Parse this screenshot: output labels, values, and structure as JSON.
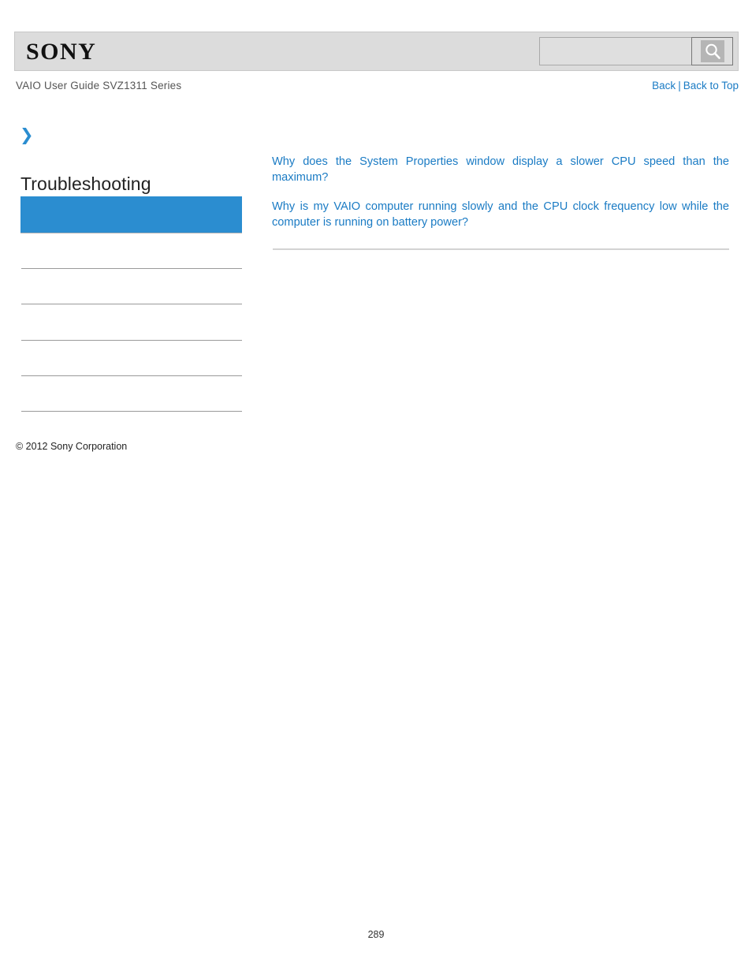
{
  "header": {
    "logo_text": "SONY",
    "search": {
      "value": "",
      "placeholder": "",
      "icon": "search-icon",
      "button_label": ""
    }
  },
  "subheader": {
    "guide_title": "VAIO User Guide SVZ1311 Series",
    "nav": {
      "back_label": "Back",
      "separator": "|",
      "back_to_top_label": "Back to Top"
    }
  },
  "sidebar": {
    "expand_icon": "chevron-right-icon",
    "heading": "Troubleshooting",
    "active_item_label": "",
    "items": [
      {
        "label": ""
      },
      {
        "label": ""
      },
      {
        "label": ""
      },
      {
        "label": ""
      },
      {
        "label": ""
      }
    ],
    "copyright": "© 2012 Sony Corporation"
  },
  "main": {
    "links": [
      "Why does the System Properties window display a slower CPU speed than the maximum?",
      "Why is my VAIO computer running slowly and the CPU clock frequency low while the computer is running on battery power?"
    ]
  },
  "footer": {
    "page_number": "289"
  },
  "colors": {
    "link_blue": "#1a7bc4",
    "accent_blue": "#2b8dd0",
    "header_gray": "#dcdcdc",
    "rule_gray": "#9a9a9a"
  }
}
